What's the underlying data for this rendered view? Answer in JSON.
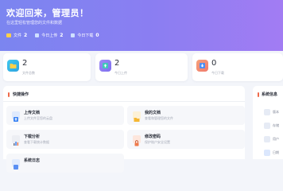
{
  "hero": {
    "title": "欢迎回来，管理员！",
    "subtitle": "在这里轻松管理您的文件和数据",
    "stats": [
      {
        "label": "文件",
        "value": "2"
      },
      {
        "label": "今日上传",
        "value": "2"
      },
      {
        "label": "今日下载",
        "value": "0"
      }
    ]
  },
  "cards": [
    {
      "value": "2",
      "label": "文件总数",
      "icon": "folder-icon",
      "color": "#3bbfe8"
    },
    {
      "value": "2",
      "label": "今日上传",
      "icon": "upload-icon",
      "color": "#8f7ef2"
    },
    {
      "value": "0",
      "label": "今日下载",
      "icon": "download-icon",
      "color": "#f07a6c"
    }
  ],
  "quick": {
    "title": "快捷操作",
    "actions": [
      {
        "title": "上传文档",
        "desc": "上传文件至您的云盘",
        "icon": "upload-icon",
        "color": "#3f86f4"
      },
      {
        "title": "我的文档",
        "desc": "查看和管理您的文件",
        "icon": "folder-icon",
        "color": "#f5b733"
      },
      {
        "title": "下载分析",
        "desc": "查看下载统计数据",
        "icon": "chart-icon",
        "color": "#9aa1b0"
      },
      {
        "title": "修改密码",
        "desc": "保护账户安全设置",
        "icon": "lock-icon",
        "color": "#f07a4a"
      },
      {
        "title": "系统日志",
        "desc": "",
        "icon": "log-icon",
        "color": "#5a8ff3"
      }
    ]
  },
  "side": {
    "title": "系统信息",
    "rows": [
      {
        "text": "版本"
      },
      {
        "text": "存储"
      },
      {
        "text": "用户"
      },
      {
        "text": "日期"
      }
    ]
  }
}
